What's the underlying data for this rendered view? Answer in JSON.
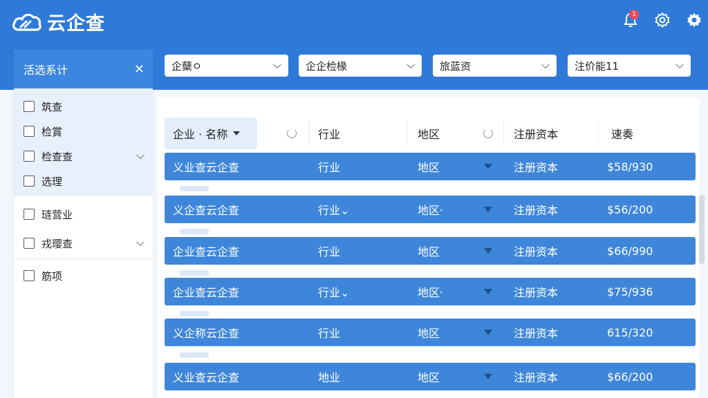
{
  "app": {
    "title": "云企查",
    "notification_count": "1"
  },
  "sidebar": {
    "title": "活选系计",
    "items": [
      {
        "label": "筑查",
        "has_chevron": false
      },
      {
        "label": "检賞",
        "has_chevron": false
      },
      {
        "label": "检查查",
        "has_chevron": true
      },
      {
        "label": "选理",
        "has_chevron": false
      },
      {
        "label": "琏营业",
        "has_chevron": false
      },
      {
        "label": "戎璎查",
        "has_chevron": true
      },
      {
        "label": "筋项",
        "has_chevron": false
      }
    ]
  },
  "filters": [
    {
      "value": "企蘖ㅇ"
    },
    {
      "value": "企企检椽"
    },
    {
      "value": "旅蓝资"
    },
    {
      "value": "注价能11"
    }
  ],
  "table": {
    "columns": [
      "企业 · 名称",
      "行业",
      "地区",
      "注册资本",
      "速奏"
    ],
    "rows": [
      {
        "name": "义业查云企查",
        "industry": "行业",
        "region": "地区",
        "capital": "注册资本",
        "amount": "$58/930"
      },
      {
        "name": "义企查云企查",
        "industry": "行业⌄",
        "region": "地区⸱",
        "capital": "注册资本",
        "amount": "$56/200"
      },
      {
        "name": "企业查云企查",
        "industry": "行业",
        "region": "地区",
        "capital": "注册资本",
        "amount": "$66/990"
      },
      {
        "name": "企业查云企查",
        "industry": "行业⌄",
        "region": "地区⸱",
        "capital": "注册资本",
        "amount": "$75/936"
      },
      {
        "name": "义企称云企查",
        "industry": "行业",
        "region": "地区",
        "capital": "注册资本",
        "amount": "615/320"
      },
      {
        "name": "义业查云企查",
        "industry": "地业",
        "region": "地区",
        "capital": "注册资本",
        "amount": "$66/200"
      }
    ]
  },
  "colors": {
    "header_blue": "#2f7ad9",
    "row_blue": "#3e86d9",
    "badge_red": "#e94b5b"
  }
}
